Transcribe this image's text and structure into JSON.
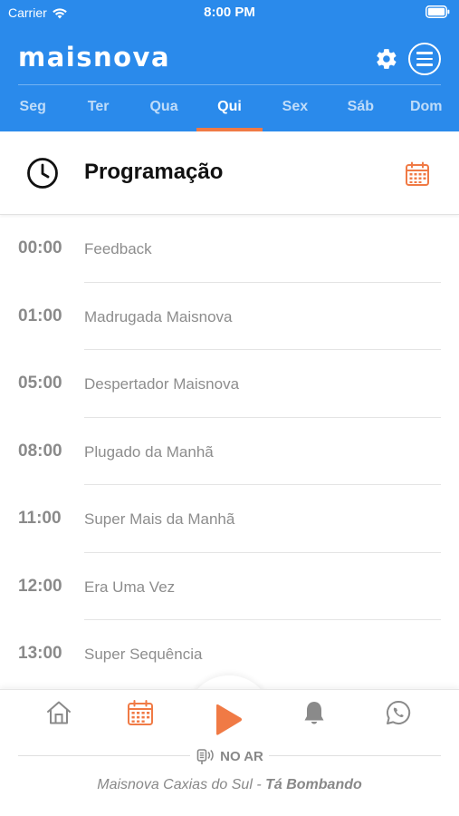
{
  "status_bar": {
    "carrier": "Carrier",
    "time": "8:00 PM"
  },
  "header": {
    "logo": "maisnova",
    "days": [
      {
        "label": "Seg",
        "active": false
      },
      {
        "label": "Ter",
        "active": false
      },
      {
        "label": "Qua",
        "active": false
      },
      {
        "label": "Qui",
        "active": true
      },
      {
        "label": "Sex",
        "active": false
      },
      {
        "label": "Sáb",
        "active": false
      },
      {
        "label": "Dom",
        "active": false
      }
    ]
  },
  "section": {
    "title": "Programação"
  },
  "schedule": [
    {
      "time": "00:00",
      "program": "Feedback"
    },
    {
      "time": "01:00",
      "program": "Madrugada Maisnova"
    },
    {
      "time": "05:00",
      "program": "Despertador Maisnova"
    },
    {
      "time": "08:00",
      "program": "Plugado da Manhã"
    },
    {
      "time": "11:00",
      "program": "Super Mais da Manhã"
    },
    {
      "time": "12:00",
      "program": "Era Uma Vez"
    },
    {
      "time": "13:00",
      "program": "Super Sequência"
    }
  ],
  "player": {
    "on_air_label": "NO AR",
    "station": "Maisnova Caxias do Sul - ",
    "program": "Tá Bombando"
  },
  "colors": {
    "brand_blue": "#2a8aeb",
    "accent_orange": "#f07a45",
    "icon_gray": "#8a8a8a"
  },
  "icons": [
    "wifi-icon",
    "battery-icon",
    "gear-icon",
    "menu-icon",
    "clock-icon",
    "calendar-icon",
    "home-icon",
    "play-icon",
    "bell-icon",
    "whatsapp-icon",
    "broadcast-icon"
  ]
}
